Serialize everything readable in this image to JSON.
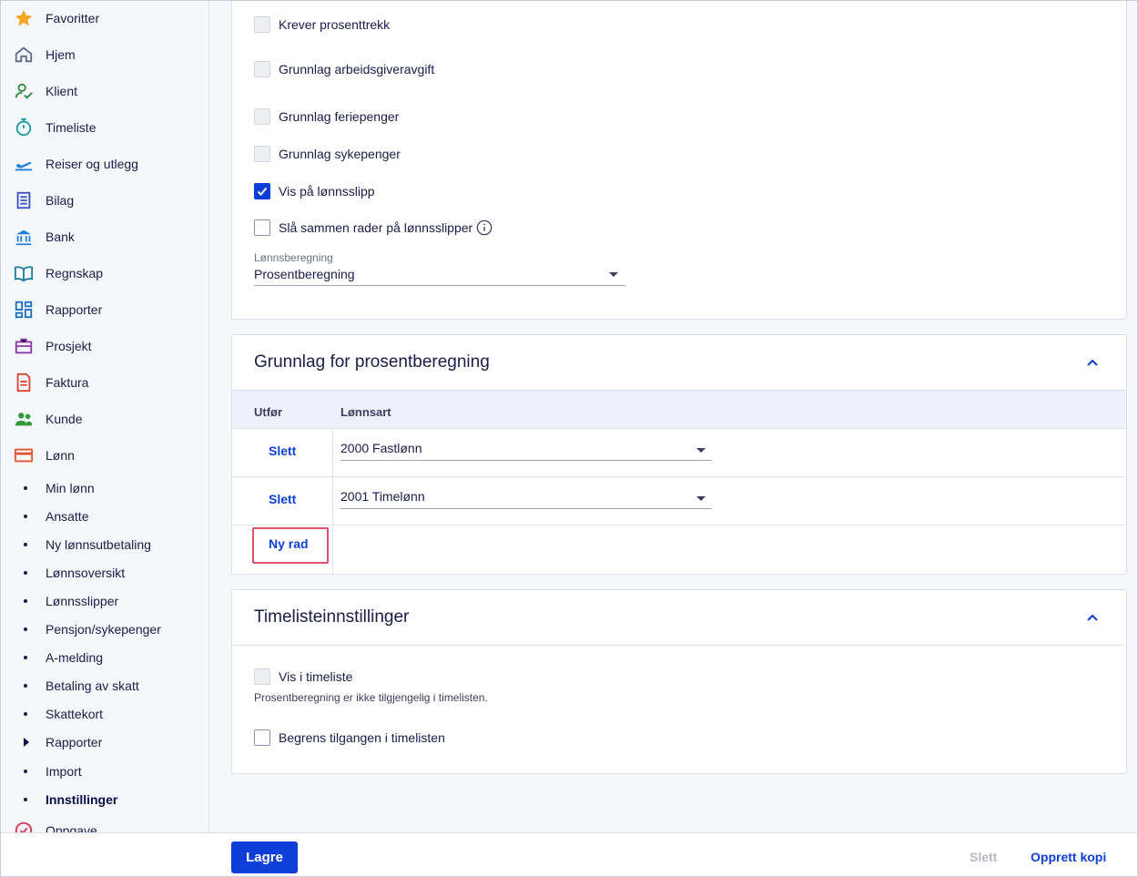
{
  "sidebar": {
    "items": [
      {
        "label": "Favoritter",
        "icon": "star-icon"
      },
      {
        "label": "Hjem",
        "icon": "home-icon"
      },
      {
        "label": "Klient",
        "icon": "client-icon"
      },
      {
        "label": "Timeliste",
        "icon": "stopwatch-icon"
      },
      {
        "label": "Reiser og utlegg",
        "icon": "plane-icon"
      },
      {
        "label": "Bilag",
        "icon": "voucher-icon"
      },
      {
        "label": "Bank",
        "icon": "bank-icon"
      },
      {
        "label": "Regnskap",
        "icon": "book-icon"
      },
      {
        "label": "Rapporter",
        "icon": "dashboard-icon"
      },
      {
        "label": "Prosjekt",
        "icon": "briefcase-icon"
      },
      {
        "label": "Faktura",
        "icon": "invoice-icon"
      },
      {
        "label": "Kunde",
        "icon": "customers-icon"
      },
      {
        "label": "Lønn",
        "icon": "salary-card-icon"
      }
    ],
    "sub_items": [
      {
        "label": "Min lønn"
      },
      {
        "label": "Ansatte"
      },
      {
        "label": "Ny lønnsutbetaling"
      },
      {
        "label": "Lønnsoversikt"
      },
      {
        "label": "Lønnsslipper"
      },
      {
        "label": "Pensjon/sykepenger"
      },
      {
        "label": "A-melding"
      },
      {
        "label": "Betaling av skatt"
      },
      {
        "label": "Skattekort"
      },
      {
        "label": "Rapporter"
      },
      {
        "label": "Import"
      },
      {
        "label": "Innstillinger"
      }
    ],
    "partial_item": "Oppgave"
  },
  "settings_card": {
    "checkboxes": [
      {
        "label": "Krever prosenttrekk",
        "checked": false,
        "disabled": true
      },
      {
        "label": "Grunnlag arbeidsgiveravgift",
        "checked": false,
        "disabled": true
      },
      {
        "label": "Grunnlag feriepenger",
        "checked": false,
        "disabled": true
      },
      {
        "label": "Grunnlag sykepenger",
        "checked": false,
        "disabled": true
      },
      {
        "label": "Vis på lønnsslipp",
        "checked": true,
        "disabled": false
      },
      {
        "label": "Slå sammen rader på lønnsslipper",
        "checked": false,
        "disabled": false
      }
    ],
    "calc_select": {
      "caption": "Lønnsberegning",
      "value": "Prosentberegning"
    }
  },
  "basis_card": {
    "title": "Grunnlag for prosentberegning",
    "columns": {
      "action": "Utfør",
      "wage_type": "Lønnsart"
    },
    "rows": [
      {
        "action": "Slett",
        "wage_type": "2000 Fastlønn"
      },
      {
        "action": "Slett",
        "wage_type": "2001 Timelønn"
      }
    ],
    "new_row": "Ny rad"
  },
  "timesheet_card": {
    "title": "Timelisteinnstillinger",
    "show_in_timesheet": {
      "label": "Vis i timeliste",
      "checked": false,
      "disabled": true
    },
    "hint": "Prosentberegning er ikke tilgjengelig i timelisten.",
    "limit_access": {
      "label": "Begrens tilgangen i timelisten",
      "checked": false,
      "disabled": false
    }
  },
  "footer": {
    "save": "Lagre",
    "delete": "Slett",
    "copy": "Opprett kopi"
  },
  "colors": {
    "accent": "#0d3ed8",
    "highlight_box": "#e0526a",
    "disabled_text": "#b7b9c6"
  }
}
